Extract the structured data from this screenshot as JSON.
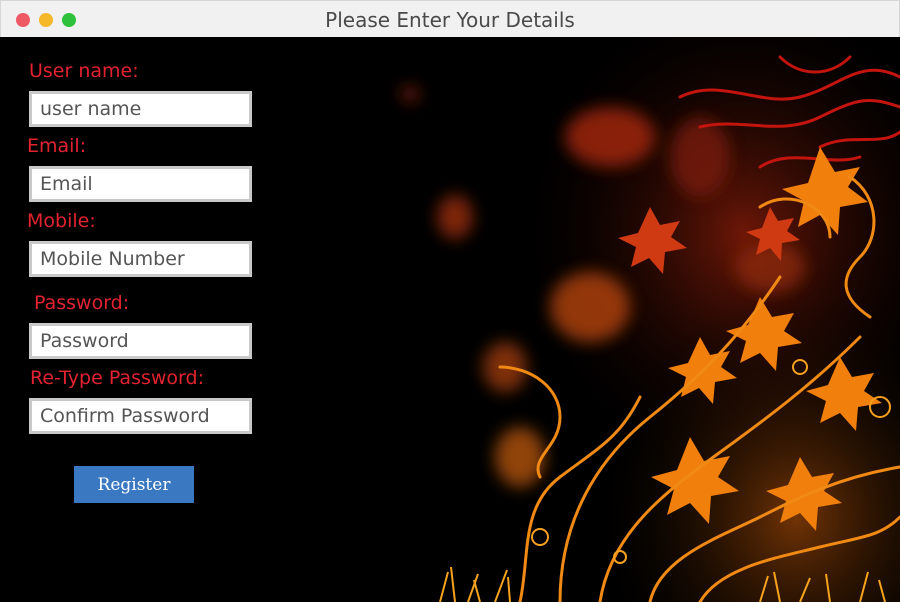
{
  "window": {
    "title": "Please Enter Your Details"
  },
  "form": {
    "username": {
      "label": "User name:",
      "placeholder": "user name"
    },
    "email": {
      "label": "Email:",
      "placeholder": "Email"
    },
    "mobile": {
      "label": "Mobile:",
      "placeholder": "Mobile Number"
    },
    "password": {
      "label": "Password:",
      "placeholder": "Password"
    },
    "retype": {
      "label": "Re-Type Password:",
      "placeholder": "Confirm Password"
    },
    "register_label": "Register"
  },
  "colors": {
    "label": "#e32230",
    "button": "#3b78c2",
    "background": "#000000"
  }
}
